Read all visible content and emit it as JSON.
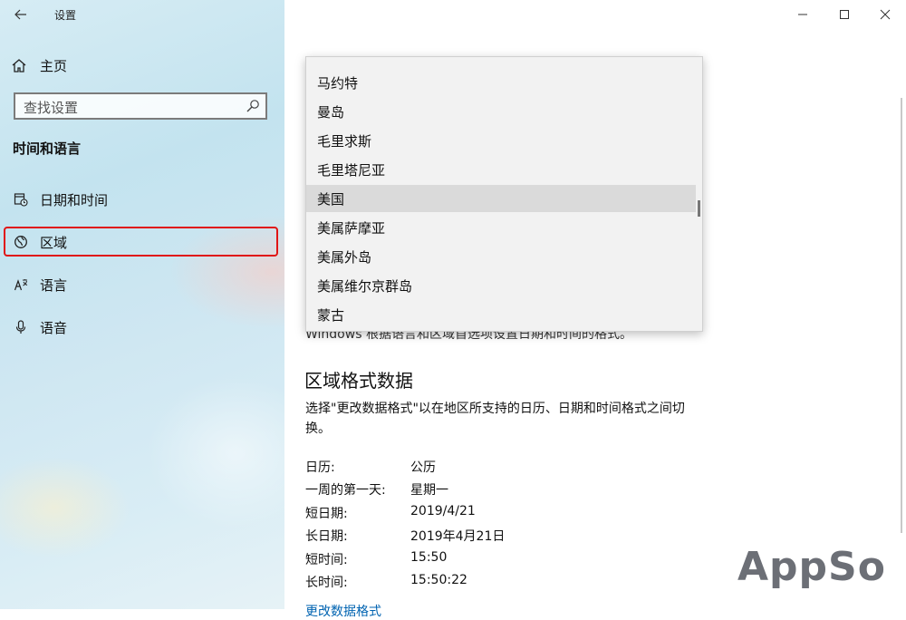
{
  "window": {
    "title": "设置",
    "controls": {
      "minimize": "minimize-icon",
      "maximize": "maximize-icon",
      "close": "close-icon"
    }
  },
  "sidebar": {
    "home_label": "主页",
    "search_placeholder": "查找设置",
    "section_title": "时间和语言",
    "items": [
      {
        "label": "日期和时间",
        "icon": "clock-calendar-icon"
      },
      {
        "label": "区域",
        "icon": "globe-icon"
      },
      {
        "label": "语言",
        "icon": "language-icon"
      },
      {
        "label": "语音",
        "icon": "microphone-icon"
      }
    ],
    "highlight_color": "#e01515"
  },
  "main": {
    "obscured_text": "Windows 根据语言和区域首选项设置日期和时间的格式。",
    "format_section": {
      "heading": "区域格式数据",
      "description": "选择\"更改数据格式\"以在地区所支持的日历、日期和时间格式之间切换。",
      "rows": [
        {
          "key": "日历:",
          "value": "公历"
        },
        {
          "key": "一周的第一天:",
          "value": "星期一"
        },
        {
          "key": "短日期:",
          "value": "2019/4/21"
        },
        {
          "key": "长日期:",
          "value": "2019年4月21日"
        },
        {
          "key": "短时间:",
          "value": "15:50"
        },
        {
          "key": "长时间:",
          "value": "15:50:22"
        }
      ],
      "change_link": "更改数据格式"
    }
  },
  "country_dropdown": {
    "options": [
      "马约特",
      "曼岛",
      "毛里求斯",
      "毛里塔尼亚",
      "美国",
      "美属萨摩亚",
      "美属外岛",
      "美属维尔京群岛",
      "蒙古"
    ],
    "selected": "美国"
  },
  "watermark": "AppSo",
  "colors": {
    "accent": "#0063b1",
    "selected_option_bg": "#dadada"
  }
}
